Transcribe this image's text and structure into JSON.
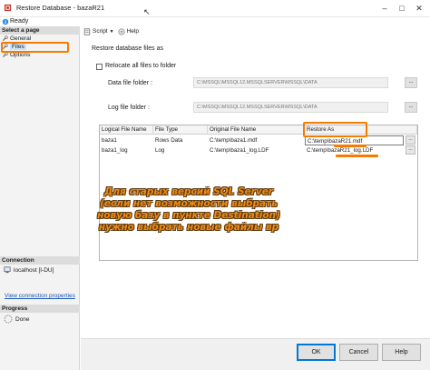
{
  "window": {
    "title": "Restore Database - bazaR21"
  },
  "status": {
    "text": "Ready"
  },
  "sidebar": {
    "select_page_header": "Select a page",
    "pages": [
      {
        "label": "General"
      },
      {
        "label": "Files",
        "selected": true
      },
      {
        "label": "Options"
      }
    ],
    "connection_header": "Connection",
    "connection_server": "localhost [I-DU]",
    "view_properties_link": "View connection properties",
    "progress_header": "Progress",
    "progress_status": "Done"
  },
  "toolbar": {
    "script_label": "Script",
    "help_label": "Help"
  },
  "files_section": {
    "group_label": "Restore database files as",
    "relocate_label": "Relocate all files to folder",
    "relocate_checked": false,
    "data_folder_label": "Data file folder :",
    "data_folder_value": "C:\\MSSQL\\MSSQL12.MSSQLSERVER\\MSSQL\\DATA",
    "log_folder_label": "Log file folder :",
    "log_folder_value": "C:\\MSSQL\\MSSQL12.MSSQLSERVER\\MSSQL\\DATA",
    "browse_label": "..."
  },
  "grid": {
    "columns": [
      "Logical File Name",
      "File Type",
      "Original File Name",
      "Restore As"
    ],
    "rows": [
      {
        "logical": "baza1",
        "type": "Rows Data",
        "original": "C:\\temp\\baza1.mdf",
        "restore_as": "C:\\temp\\bazaR21.mdf"
      },
      {
        "logical": "baza1_log",
        "type": "Log",
        "original": "C:\\temp\\baza1_log.LDF",
        "restore_as": "C:\\temp\\bazaR21_log.LDF"
      }
    ],
    "row_button_label": "..."
  },
  "annotation": {
    "text": "Для старых версий SQL Server (если нет возможности выбрать новую базу в пункте Destination) нужно выбрать новые файлы вр",
    "color": "#f08a14"
  },
  "buttons": {
    "ok": "OK",
    "cancel": "Cancel",
    "help": "Help"
  },
  "colors": {
    "highlight": "#f57c00",
    "link": "#1a57b4"
  }
}
